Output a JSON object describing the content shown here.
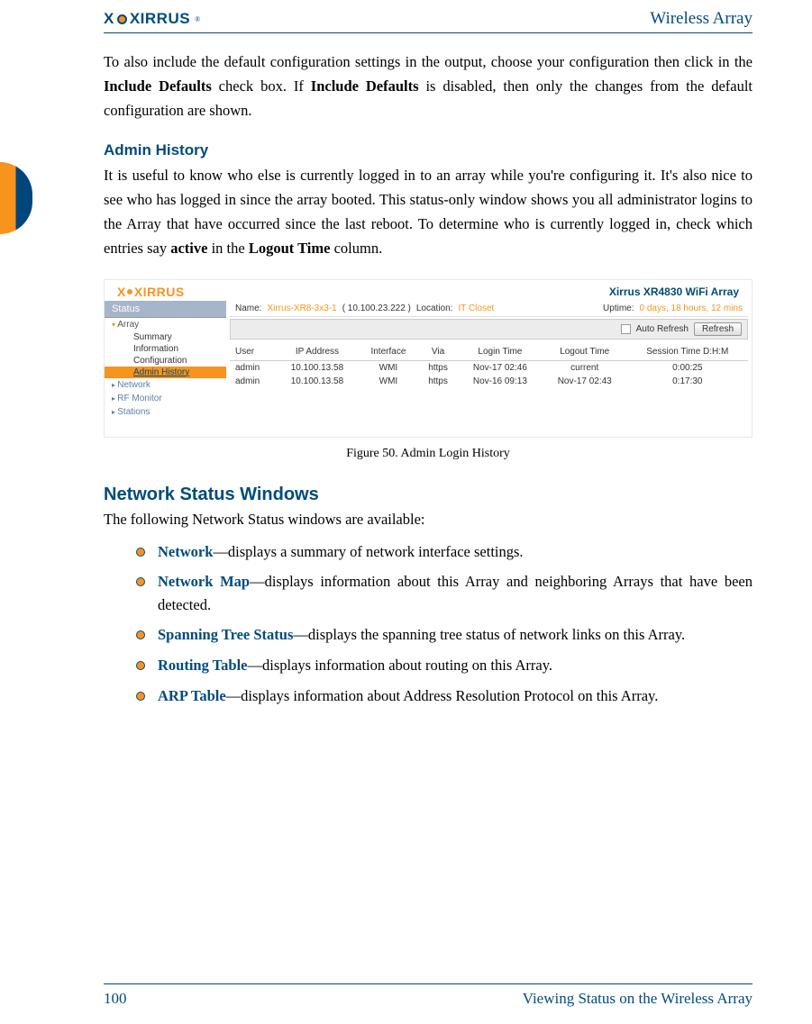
{
  "header": {
    "logo_text": "XIRRUS",
    "doc_title": "Wireless Array"
  },
  "intro_para": {
    "pre": "To also include the default configuration settings in the output, choose your configuration then click in the ",
    "b1": "Include Defaults",
    "mid1": " check box. If ",
    "b2": "Include Defaults",
    "post": " is disabled, then only the changes from the default configuration are shown."
  },
  "admin_history": {
    "heading": "Admin History",
    "para_pre": "It is useful to know who else is currently logged in to an array while you're configuring it. It's also nice to see who has logged in since the array booted. This status-only window shows you all administrator logins to the Array that have occurred since the last reboot. To determine who is currently logged in, check which entries say ",
    "b1": "active",
    "mid": " in the ",
    "b2": "Logout Time",
    "post": " column."
  },
  "screenshot": {
    "logo": "XIRRUS",
    "model": "Xirrus XR4830 WiFi Array",
    "sidebar": {
      "status": "Status",
      "array": "Array",
      "items": [
        "Summary",
        "Information",
        "Configuration"
      ],
      "active": "Admin History",
      "others": [
        "Network",
        "RF Monitor",
        "Stations"
      ]
    },
    "infobar": {
      "name_lbl": "Name:",
      "name_val": "Xirrus-XR8-3x3-1",
      "ip": "( 10.100.23.222 )",
      "loc_lbl": "Location:",
      "loc_val": "IT Closet",
      "up_lbl": "Uptime:",
      "up_val": "0 days, 18 hours, 12 mins"
    },
    "toolbar": {
      "auto_refresh": "Auto Refresh",
      "refresh": "Refresh"
    },
    "table": {
      "headers": [
        "User",
        "IP Address",
        "Interface",
        "Via",
        "Login Time",
        "Logout Time",
        "Session Time D:H:M"
      ],
      "rows": [
        [
          "admin",
          "10.100.13.58",
          "WMI",
          "https",
          "Nov-17 02:46",
          "current",
          "0:00:25"
        ],
        [
          "admin",
          "10.100.13.58",
          "WMI",
          "https",
          "Nov-16 09:13",
          "Nov-17 02:43",
          "0:17:30"
        ]
      ]
    }
  },
  "figure_caption": "Figure 50. Admin Login History",
  "network_section": {
    "heading": "Network Status Windows",
    "intro": "The following Network Status windows are available:",
    "bullets": [
      {
        "term": "Network",
        "desc": "—displays a summary of network interface settings."
      },
      {
        "term": "Network Map",
        "desc": "—displays information about this Array and neighboring Arrays that have been detected."
      },
      {
        "term": "Spanning Tree Status",
        "desc": "—displays the spanning tree status of network links on this Array."
      },
      {
        "term": "Routing Table",
        "desc": "—displays information about routing on this Array."
      },
      {
        "term": "ARP Table",
        "desc": "—displays information about Address Resolution Protocol on this Array."
      }
    ]
  },
  "footer": {
    "page": "100",
    "title": "Viewing Status on the Wireless Array"
  }
}
